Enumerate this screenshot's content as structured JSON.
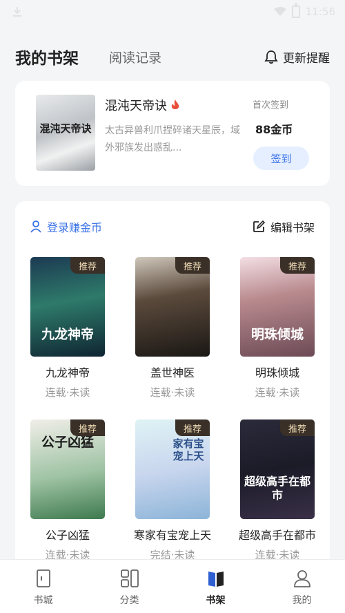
{
  "status_bar": {
    "time": "11:56"
  },
  "header": {
    "tab_active": "我的书架",
    "tab_history": "阅读记录",
    "update_reminder": "更新提醒"
  },
  "checkin": {
    "cover_text": "混沌天帝诀",
    "title": "混沌天帝诀",
    "description": "太古异兽利爪捏碎诸天星辰，域外邪族发出惑乱...",
    "label": "首次签到",
    "reward": "88金币",
    "button": "签到"
  },
  "shelf": {
    "login_link": "登录赚金币",
    "edit_label": "编辑书架",
    "books": [
      {
        "title": "九龙神帝",
        "status": "连载·未读",
        "badge": "推荐",
        "cover_text": "九龙神帝"
      },
      {
        "title": "盖世神医",
        "status": "连载·未读",
        "badge": "推荐",
        "cover_text": ""
      },
      {
        "title": "明珠倾城",
        "status": "连载·未读",
        "badge": "推荐",
        "cover_text": "明珠倾城"
      },
      {
        "title": "公子凶猛",
        "status": "连载·未读",
        "badge": "推荐",
        "cover_text": "公子凶猛"
      },
      {
        "title": "寒家有宝宠上天",
        "status": "完结·未读",
        "badge": "推荐",
        "cover_text": "家有宝宠上天"
      },
      {
        "title": "超级高手在都市",
        "status": "连载·未读",
        "badge": "推荐",
        "cover_text": "超级高手在都市"
      }
    ]
  },
  "bottom_nav": {
    "items": [
      {
        "label": "书城",
        "icon": "bookstore-icon"
      },
      {
        "label": "分类",
        "icon": "category-icon"
      },
      {
        "label": "书架",
        "icon": "bookshelf-icon"
      },
      {
        "label": "我的",
        "icon": "profile-icon"
      }
    ],
    "active": "书架"
  },
  "colors": {
    "accent": "#3a73e6",
    "badge_bg": "#3a3028",
    "badge_text": "#f3dfb8"
  }
}
